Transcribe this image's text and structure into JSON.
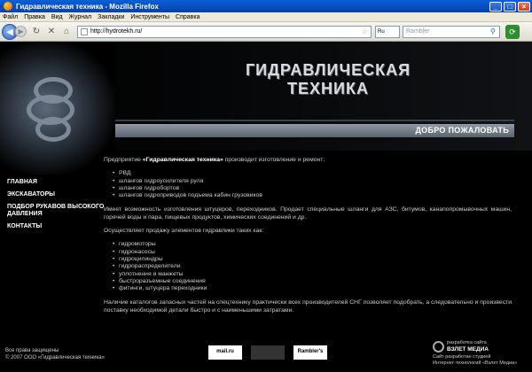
{
  "window": {
    "title": "Гидравлическая техника - Mozilla Firefox"
  },
  "menu": [
    "Файл",
    "Правка",
    "Вид",
    "Журнал",
    "Закладки",
    "Инструменты",
    "Справка"
  ],
  "navbar": {
    "url": "http://hydrotekh.ru/",
    "lang": "Ru",
    "search_placeholder": "Rambler"
  },
  "header": {
    "brand_line1": "ГИДРАВЛИЧЕСКАЯ",
    "brand_line2": "ТЕХНИКА",
    "welcome": "ДОБРО ПОЖАЛОВАТЬ"
  },
  "sidebar": {
    "items": [
      {
        "label": "ГЛАВНАЯ"
      },
      {
        "label": "ЭКСКАВАТОРЫ"
      },
      {
        "label": "ПОДБОР РУКАВОВ ВЫСОКОГО ДАВЛЕНИЯ"
      },
      {
        "label": "КОНТАКТЫ"
      }
    ]
  },
  "content": {
    "intro_before": "Предприятие ",
    "intro_company": "«Гидравлическая техника»",
    "intro_after": " производит изготовление и ремонт:",
    "list1": [
      "РВД",
      "шлангов гидроусилителя руля",
      "шлангов гидробортов",
      "шлангов гидроприводов подъема кабин грузовиков"
    ],
    "para2": "Имеет возможность изготовления штуцеров, переходников. Продает специальные шланги для АЗС, битумов, канапопромывочных машин, горячей воды и пара, пищевых продуктов, химических соединений и др.",
    "para3": "Осуществляет продажу элементов гидравлики таких как:",
    "list2": [
      "гидромоторы",
      "гидронасосы",
      "гидроцилиндры",
      "гидрораспределители",
      "уплотнения и манжеты",
      "быстроразъемные соединения",
      "фитинги, штуцера переходники"
    ],
    "para4": "Наличие каталогов запасных частей на спецтехнику практически всех производителей СНГ позволяет подобрать, а следовательно и произвести поставку необходимой детали быстро и с наименьшими затратами."
  },
  "footer": {
    "rights": "Все права защищены",
    "copyright": "© 2007 ООО «Гидравлическая техника»",
    "counters": [
      "mail.ru",
      "",
      "Rambler's TOP100"
    ],
    "studio_small": "разработка сайта",
    "studio_logo": "ВЗЛЕТ МЕДИА",
    "studio_line1": "Сайт разработан студией",
    "studio_line2": "Интернет-технологий «Взлет Медиа»"
  }
}
